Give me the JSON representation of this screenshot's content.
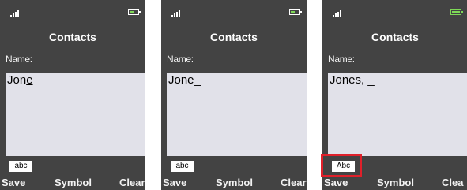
{
  "highlight_color": "#e0202a",
  "phones": [
    {
      "status": {
        "signal_icon": "signal-bars-icon",
        "battery_icon": "battery-icon"
      },
      "title": "Contacts",
      "field_label": "Name:",
      "text_before_cursor": "Jon",
      "cursor_char": "e",
      "text_after": "",
      "input_mode": "abc",
      "softkeys": {
        "left": "Save",
        "middle": "Symbol",
        "right": "Clear"
      }
    },
    {
      "status": {
        "signal_icon": "signal-bars-icon",
        "battery_icon": "battery-icon"
      },
      "title": "Contacts",
      "field_label": "Name:",
      "text_before_cursor": "Jone",
      "cursor_char": "_",
      "text_after": "",
      "input_mode": "abc",
      "softkeys": {
        "left": "Save",
        "middle": "Symbol",
        "right": "Clear"
      }
    },
    {
      "status": {
        "signal_icon": "signal-bars-icon",
        "battery_icon": "battery-icon"
      },
      "title": "Contacts",
      "field_label": "Name:",
      "text_before_cursor": "Jones, ",
      "cursor_char": "_",
      "text_after": "",
      "input_mode": "Abc",
      "softkeys": {
        "left": "Save",
        "middle": "Symbol",
        "right": "Clea"
      }
    }
  ]
}
